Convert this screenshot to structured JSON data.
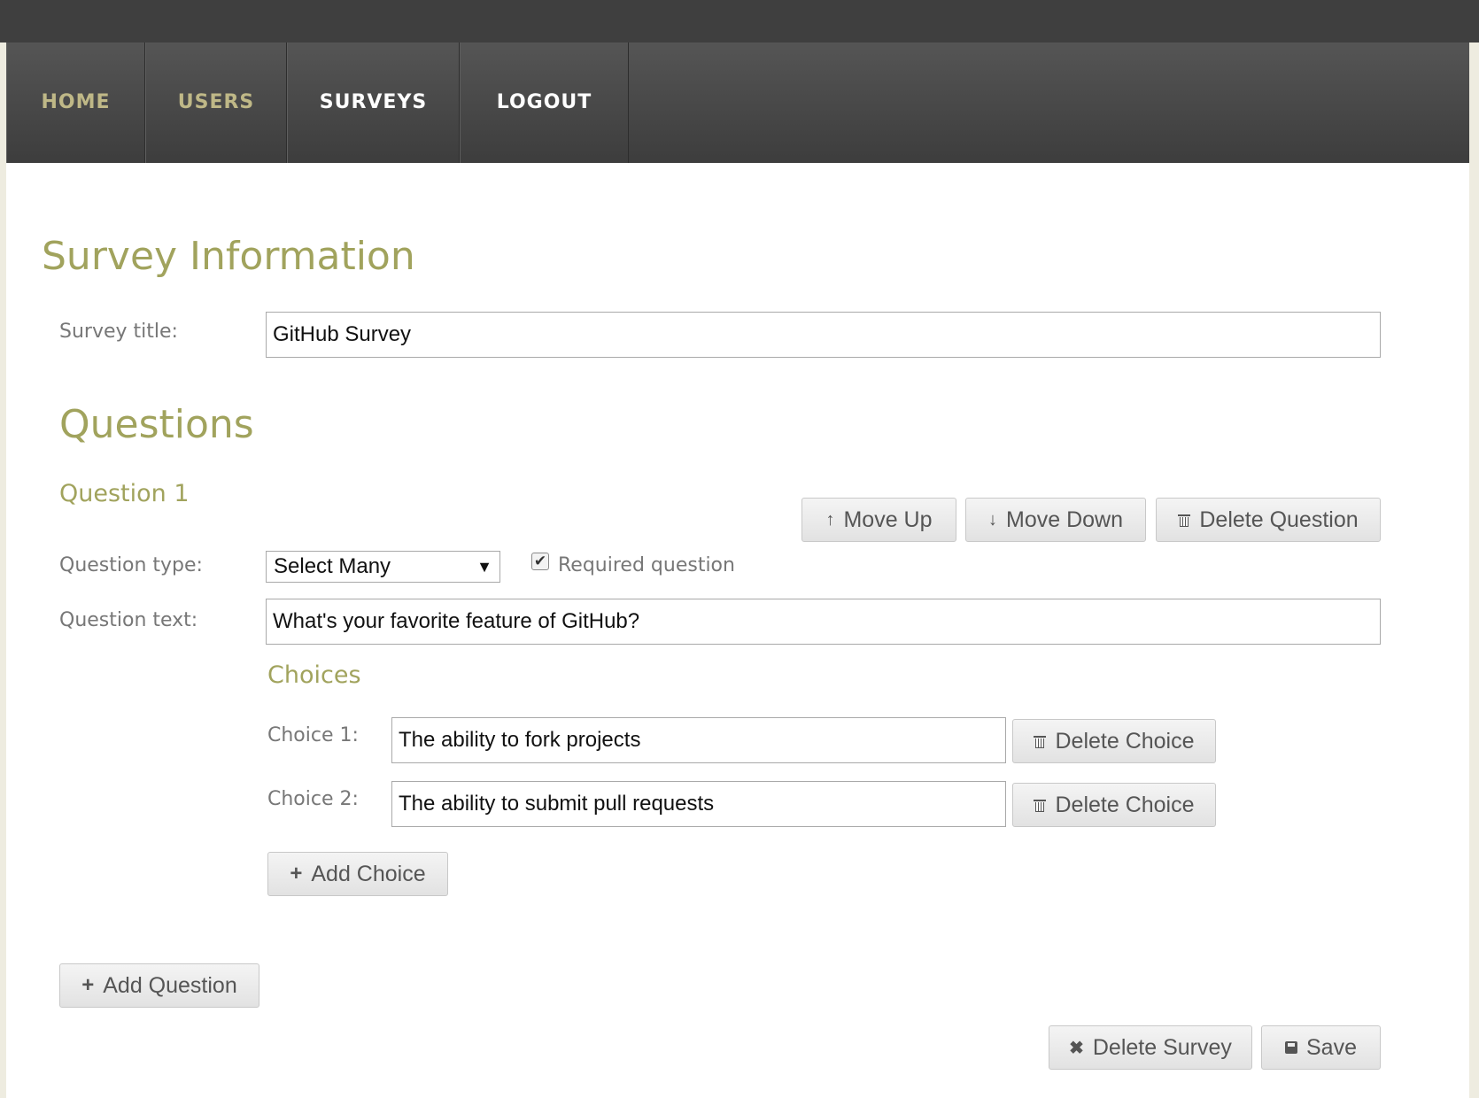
{
  "nav": {
    "home": "HOME",
    "users": "USERS",
    "surveys": "SURVEYS",
    "logout": "LOGOUT"
  },
  "survey": {
    "heading": "Survey Information",
    "title_label": "Survey title:",
    "title_value": "GitHub Survey"
  },
  "questions": {
    "heading": "Questions",
    "add_question_label": "Add Question",
    "items": [
      {
        "heading": "Question 1",
        "move_up_label": "Move Up",
        "move_down_label": "Move Down",
        "delete_label": "Delete Question",
        "type_label": "Question type:",
        "type_value": "Select Many",
        "required_checked": true,
        "required_label": "Required question",
        "text_label": "Question text:",
        "text_value": "What's your favorite feature of GitHub?",
        "choices_heading": "Choices",
        "choices": [
          {
            "label": "Choice 1:",
            "value": "The ability to fork projects",
            "delete_label": "Delete Choice"
          },
          {
            "label": "Choice 2:",
            "value": "The ability to submit pull requests",
            "delete_label": "Delete Choice"
          }
        ],
        "add_choice_label": "Add Choice"
      }
    ]
  },
  "footer": {
    "delete_survey_label": "Delete Survey",
    "save_label": "Save"
  },
  "icons": {
    "move_up": "arrow-up-icon",
    "move_down": "arrow-down-icon",
    "delete": "trash-icon",
    "add": "plus-icon",
    "delete_survey": "x-icon",
    "save": "save-icon"
  },
  "colors": {
    "heading": "#a1a35d",
    "nav_muted": "#bfb887",
    "nav_active": "#ffffff",
    "nav_bg": "#4a4a4a"
  }
}
